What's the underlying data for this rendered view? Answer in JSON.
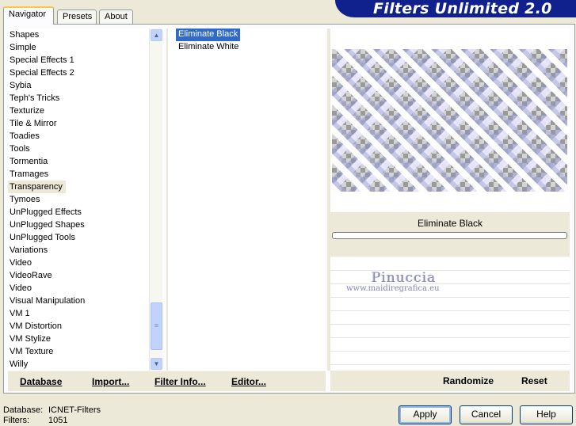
{
  "tabs": [
    "Navigator",
    "Presets",
    "About"
  ],
  "banner_title": "Filters Unlimited 2.0",
  "categories": [
    "Shapes",
    "Simple",
    "Special Effects 1",
    "Special Effects 2",
    "Sybia",
    "Teph's Tricks",
    "Texturize",
    "Tile & Mirror",
    "Toadies",
    "Tools",
    "Tormentia",
    "Tramages",
    "Transparency",
    "Tymoes",
    "UnPlugged Effects",
    "UnPlugged Shapes",
    "UnPlugged Tools",
    "Variations",
    "Video",
    "VideoRave",
    "Video",
    "Visual Manipulation",
    "VM 1",
    "VM Distortion",
    "VM Stylize",
    "VM Texture",
    "Willy"
  ],
  "selected_category": "Transparency",
  "filters": [
    "Eliminate Black",
    "Eliminate White"
  ],
  "selected_filter": "Eliminate Black",
  "preview_filter_name": "Eliminate Black",
  "watermark": {
    "name": "Pinuccia",
    "url": "www.maidiregrafica.eu"
  },
  "bottom_left": {
    "database": "Database",
    "import": "Import...",
    "filter_info": "Filter Info...",
    "editor": "Editor..."
  },
  "bottom_right": {
    "randomize": "Randomize",
    "reset": "Reset"
  },
  "status": {
    "database_label": "Database:",
    "database_value": "ICNET-Filters",
    "filters_label": "Filters:",
    "filters_value": "1051"
  },
  "buttons": {
    "apply": "Apply",
    "cancel": "Cancel",
    "help": "Help"
  },
  "colors": {
    "banner": "#10208c",
    "selection": "#316ac5",
    "dialog_bg": "#ece9d8"
  }
}
